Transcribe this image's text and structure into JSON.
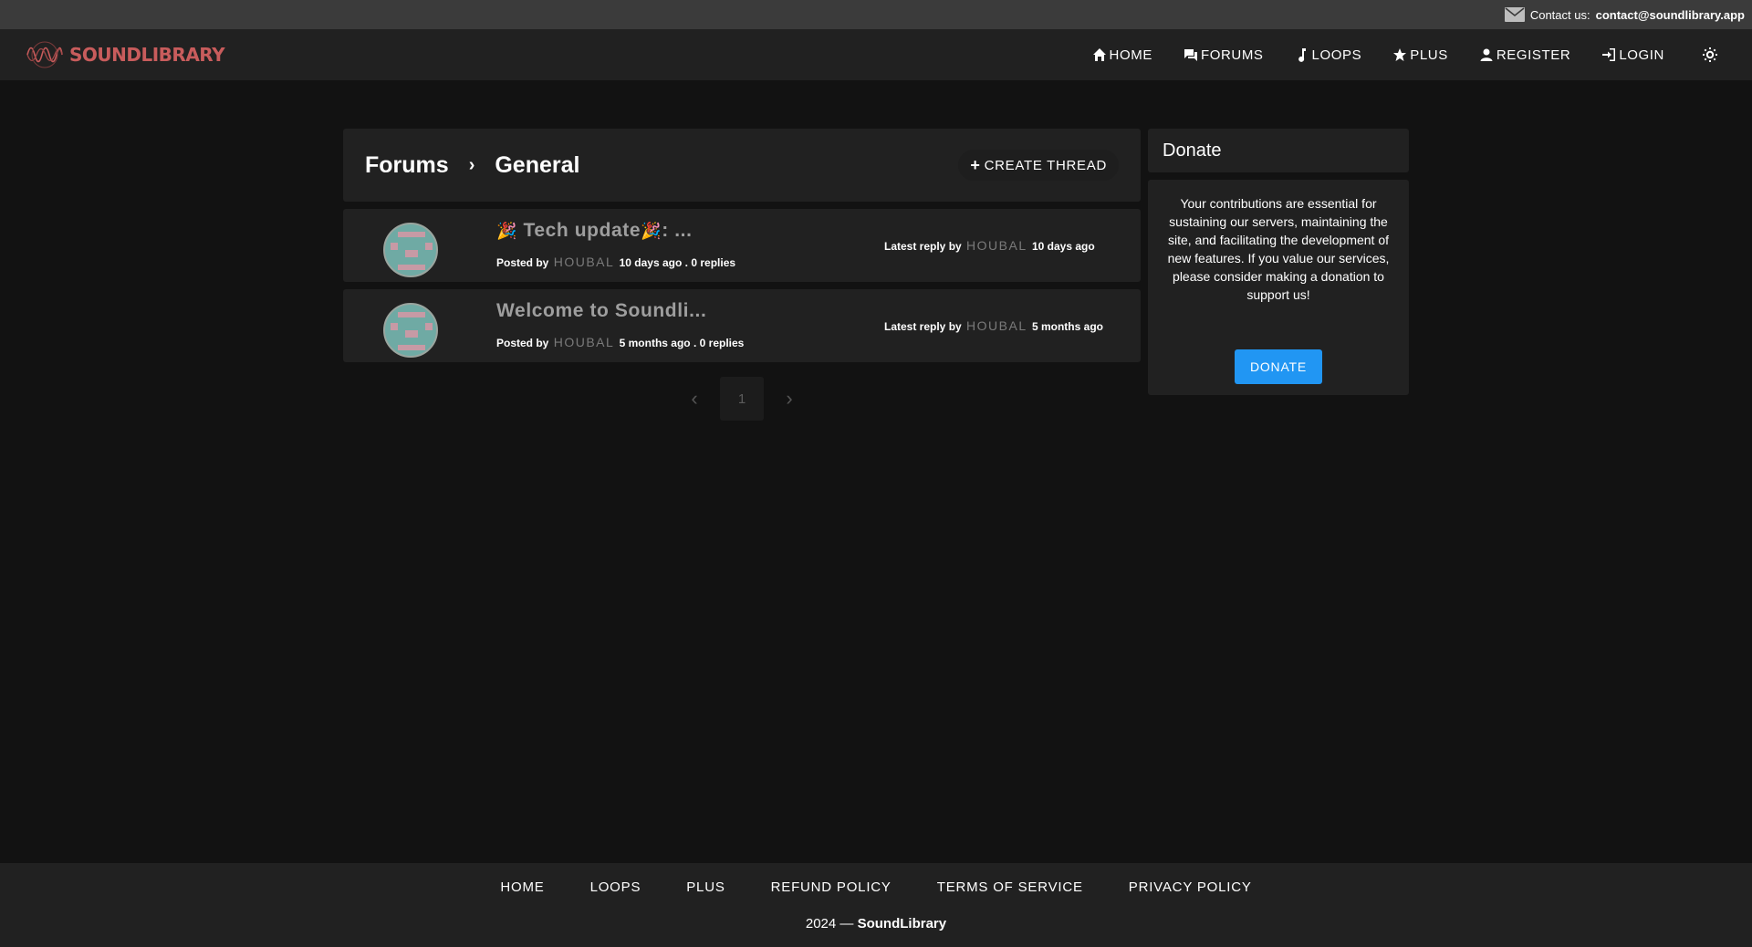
{
  "topbar": {
    "contact_label": "Contact us:",
    "contact_email": "contact@soundlibrary.app"
  },
  "brand": {
    "name": "SOUNDLIBRARY",
    "color": "#c85c5c"
  },
  "nav": {
    "home": "HOME",
    "forums": "FORUMS",
    "loops": "LOOPS",
    "plus": "PLUS",
    "register": "REGISTER",
    "login": "LOGIN"
  },
  "breadcrumb": {
    "root": "Forums",
    "current": "General"
  },
  "create_thread_label": "CREATE THREAD",
  "threads": [
    {
      "title_pre_emoji": "🎉",
      "title": "Tech update",
      "title_post_emoji": "🎉",
      "title_suffix": ": ...",
      "posted_by_label": "Posted by",
      "author": "HOUBAL",
      "age": "10 days ago",
      "replies": ". 0 replies",
      "latest_label": "Latest reply by",
      "latest_user": "HOUBAL",
      "latest_age": "10 days ago"
    },
    {
      "title_pre_emoji": "",
      "title": "Welcome to Soundli...",
      "title_post_emoji": "",
      "title_suffix": "",
      "posted_by_label": "Posted by",
      "author": "HOUBAL",
      "age": "5 months ago",
      "replies": ". 0 replies",
      "latest_label": "Latest reply by",
      "latest_user": "HOUBAL",
      "latest_age": "5 months ago"
    }
  ],
  "pagination": {
    "prev": "‹",
    "current_page": "1",
    "next": "›"
  },
  "donate": {
    "title": "Donate",
    "text": "Your contributions are essential for sustaining our servers, maintaining the site, and facilitating the development of new features. If you value our services, please consider making a donation to support us!",
    "button": "DONATE",
    "button_color": "#2196f3"
  },
  "footer": {
    "links": [
      "HOME",
      "LOOPS",
      "PLUS",
      "REFUND POLICY",
      "TERMS OF SERVICE",
      "PRIVACY POLICY"
    ],
    "year": "2024 —",
    "site": "SoundLibrary"
  }
}
